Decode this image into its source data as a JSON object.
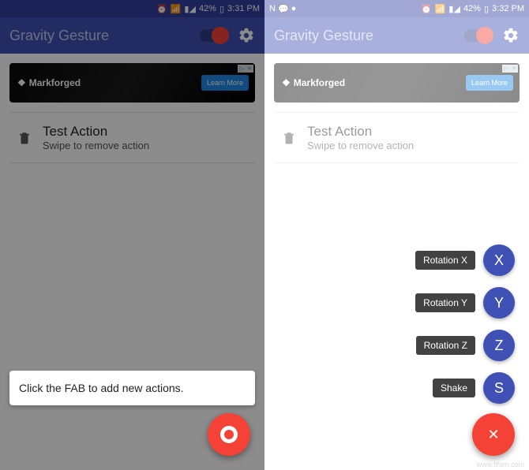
{
  "left": {
    "status": {
      "battery": "42%",
      "time": "3:31 PM"
    },
    "appbar": {
      "title": "Gravity Gesture"
    },
    "ad": {
      "brand": "Markforged",
      "cta": "Learn More",
      "adchoices": "▷",
      "close": "✕"
    },
    "action": {
      "title": "Test Action",
      "subtitle": "Swipe to remove action"
    },
    "tooltip": "Click the FAB to add new actions."
  },
  "right": {
    "status": {
      "battery": "42%",
      "time": "3:32 PM",
      "notif1": "N",
      "notif2": "●"
    },
    "appbar": {
      "title": "Gravity Gesture"
    },
    "ad": {
      "brand": "Markforged",
      "cta": "Learn More",
      "adchoices": "▷",
      "close": "✕"
    },
    "action": {
      "title": "Test Action",
      "subtitle": "Swipe to remove action"
    },
    "speeddial": [
      {
        "label": "Rotation X",
        "letter": "X"
      },
      {
        "label": "Rotation Y",
        "letter": "Y"
      },
      {
        "label": "Rotation Z",
        "letter": "Z"
      },
      {
        "label": "Shake",
        "letter": "S"
      }
    ],
    "fab_close": "✕"
  },
  "watermark": "www.fifam.com"
}
